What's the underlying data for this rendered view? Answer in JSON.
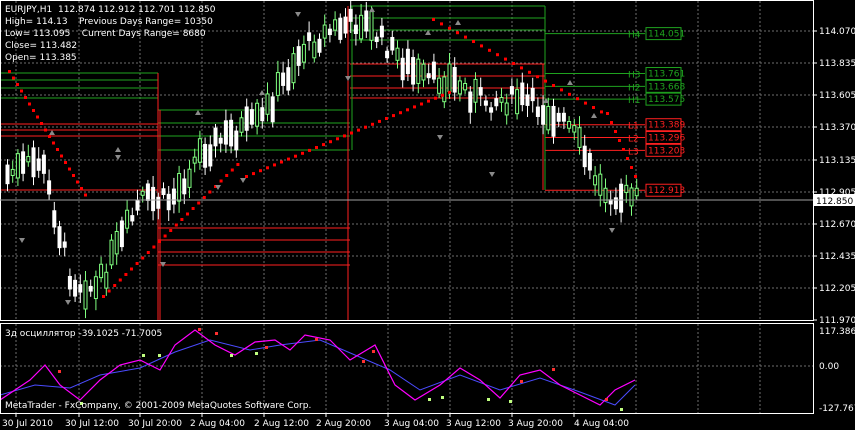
{
  "header": {
    "symbol": "EURJPY,H1",
    "ohlc": "112.874 112.912 112.701 112.850",
    "high": "High= 114.13",
    "prev_range": "Previous Days Range= 10350",
    "low": "Low= 113.095",
    "cur_range": "Current Days Range= 8680",
    "close": "Close= 113.482",
    "open": "Open= 113.385"
  },
  "price_axis": [
    "114.070",
    "113.835",
    "113.605",
    "113.370",
    "113.135",
    "112.905",
    "112.670",
    "112.435",
    "112.205",
    "111.970"
  ],
  "current_price": "112.850",
  "levels": [
    {
      "label": "H4",
      "value": "114.051",
      "color": "#1fa31f",
      "price": 114.051
    },
    {
      "label": "H3",
      "value": "113.761",
      "color": "#1fa31f",
      "price": 113.761
    },
    {
      "label": "H2",
      "value": "113.668",
      "color": "#1fa31f",
      "price": 113.668
    },
    {
      "label": "H1",
      "value": "113.575",
      "color": "#1fa31f",
      "price": 113.575
    },
    {
      "label": "L1",
      "value": "113.389",
      "color": "#ff2020",
      "price": 113.389
    },
    {
      "label": "L2",
      "value": "113.296",
      "color": "#ff2020",
      "price": 113.296
    },
    {
      "label": "L3",
      "value": "113.203",
      "color": "#ff2020",
      "price": 113.203
    },
    {
      "label": "",
      "value": "112.913",
      "color": "#ff2020",
      "price": 112.913
    }
  ],
  "oscillator": {
    "title": "3д осциллятор -39.1025 -71.7005",
    "axis": [
      "117.3864",
      "0.00",
      "-127.7678"
    ]
  },
  "time_axis": [
    "30 Jul 2010",
    "30 Jul 12:00",
    "30 Jul 20:00",
    "2 Aug 04:00",
    "2 Aug 12:00",
    "2 Aug 20:00",
    "3 Aug 04:00",
    "3 Aug 12:00",
    "3 Aug 20:00",
    "4 Aug 04:00"
  ],
  "copyright": "MetaTrader - FxCompany, © 2001-2009 MetaQuotes Software Corp.",
  "colors": {
    "bull": "#80ff80",
    "bear": "#ffffff",
    "grid": "#6e6e6e",
    "sar": "#ff0000",
    "osc_main": "#ff00ff",
    "osc_signal": "#4b4bff",
    "resistance": "#1fa31f",
    "support": "#ff2020"
  }
}
